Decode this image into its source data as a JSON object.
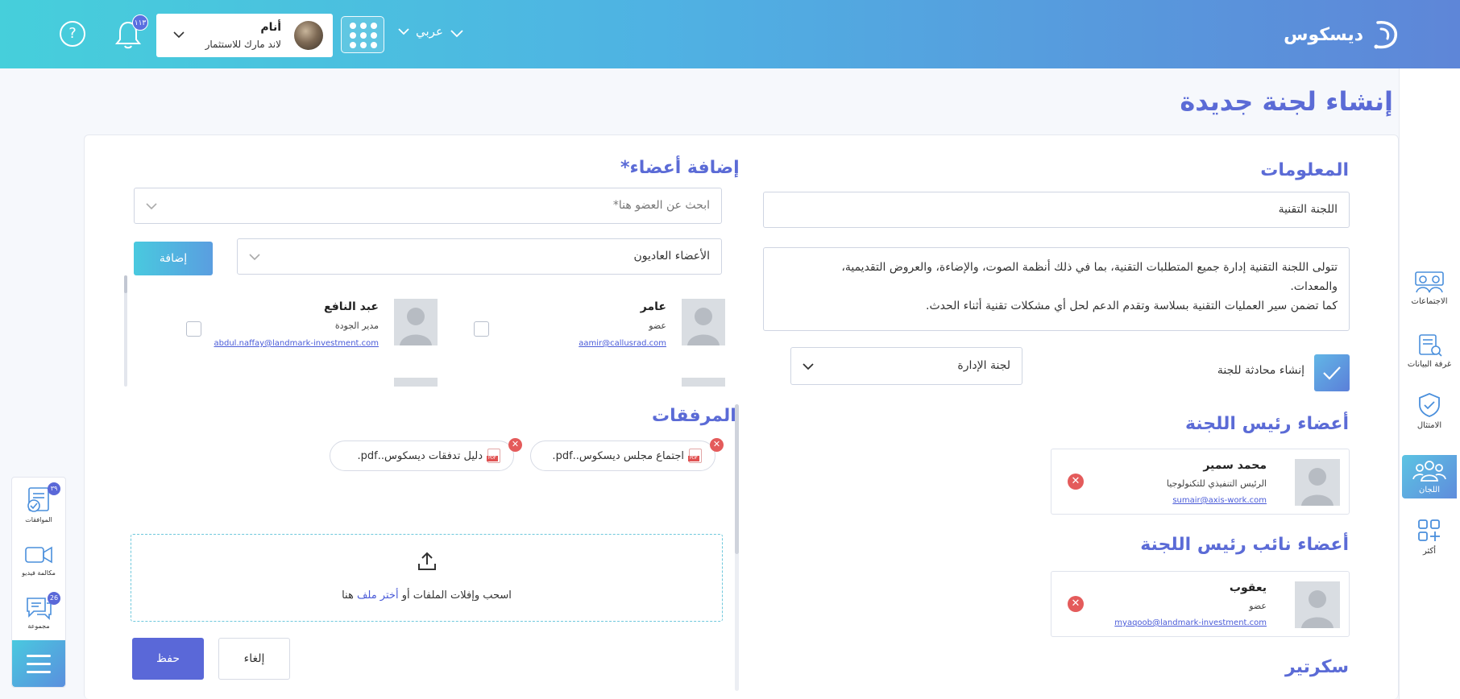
{
  "header": {
    "logo_text": "ديسكوس",
    "language": "عربي",
    "user": {
      "name": "أنام",
      "org": "لاند مارك للاستثمار"
    },
    "notifications_badge": "١١٣",
    "help_label": "?"
  },
  "sidebar": {
    "items": [
      {
        "label": "الاجتماعات",
        "icon": "meetings-icon"
      },
      {
        "label": "غرفة البيانات",
        "icon": "data-room-icon"
      },
      {
        "label": "الامتثال",
        "icon": "compliance-shield-icon"
      },
      {
        "label": "اللجان",
        "icon": "committees-icon",
        "active": true
      },
      {
        "label": "أكثر",
        "icon": "more-grid-icon"
      }
    ]
  },
  "page": {
    "title": "إنشاء لجنة جديدة"
  },
  "info": {
    "title": "المعلومات",
    "name_value": "اللجنة التقنية",
    "description_line1": "تتولى اللجنة التقنية إدارة جميع المتطلبات التقنية، بما في ذلك أنظمة الصوت، والإضاءة، والعروض التقديمية،",
    "description_line2": "والمعدات.",
    "description_line3": "كما تضمن سير العمليات التقنية بسلاسة وتقدم الدعم لحل أي مشكلات تقنية أثناء الحدث.",
    "create_chat_label": "إنشاء محادثة للجنة",
    "create_chat_checked": true,
    "committee_type_value": "لجنة الإدارة"
  },
  "chair": {
    "title": "أعضاء رئيس اللجنة",
    "member": {
      "name": "محمد سمير",
      "role": "الرئيس التنفيذي للتكنولوجيا",
      "email": "sumair@axis-work.com"
    }
  },
  "vice_chair": {
    "title": "أعضاء نائب رئيس اللجنة",
    "member": {
      "name": "يعقوب",
      "role": "عضو",
      "email": "myaqoob@landmark-investment.com"
    }
  },
  "secretary": {
    "title": "سكرتير"
  },
  "add_members": {
    "title": "إضافة أعضاء*",
    "search_placeholder": "ابحث عن العضو هنا*",
    "member_type_value": "الأعضاء العاديون",
    "add_button": "إضافة",
    "list": [
      {
        "name": "عامر",
        "role": "عضو",
        "email": "aamir@callusrad.com"
      },
      {
        "name": "عبد النافع",
        "role": "مدير الجودة",
        "email": "abdul.naffay@landmark-investment.com"
      }
    ]
  },
  "attachments": {
    "title": "المرفقات",
    "files": [
      {
        "name": "اجتماع مجلس ديسكوس..pdf."
      },
      {
        "name": "دليل تدفقات ديسكوس..pdf."
      }
    ],
    "dropzone_text": "اسحب وإفلات الملفات أو",
    "dropzone_link": "أختر ملف",
    "dropzone_suffix": "هنا"
  },
  "actions": {
    "cancel": "إلغاء",
    "save": "حفظ"
  },
  "quick_panel": {
    "approvals": {
      "label": "الموافقات",
      "badge": "٣٩"
    },
    "video_call": {
      "label": "مكالمة فيديو"
    },
    "group": {
      "label": "مجموعة",
      "badge": "26"
    }
  },
  "colors": {
    "accent": "#5b6bd6",
    "gradient_start": "#46cfdb",
    "gradient_end": "#5e86d8",
    "danger": "#e45b5b"
  }
}
